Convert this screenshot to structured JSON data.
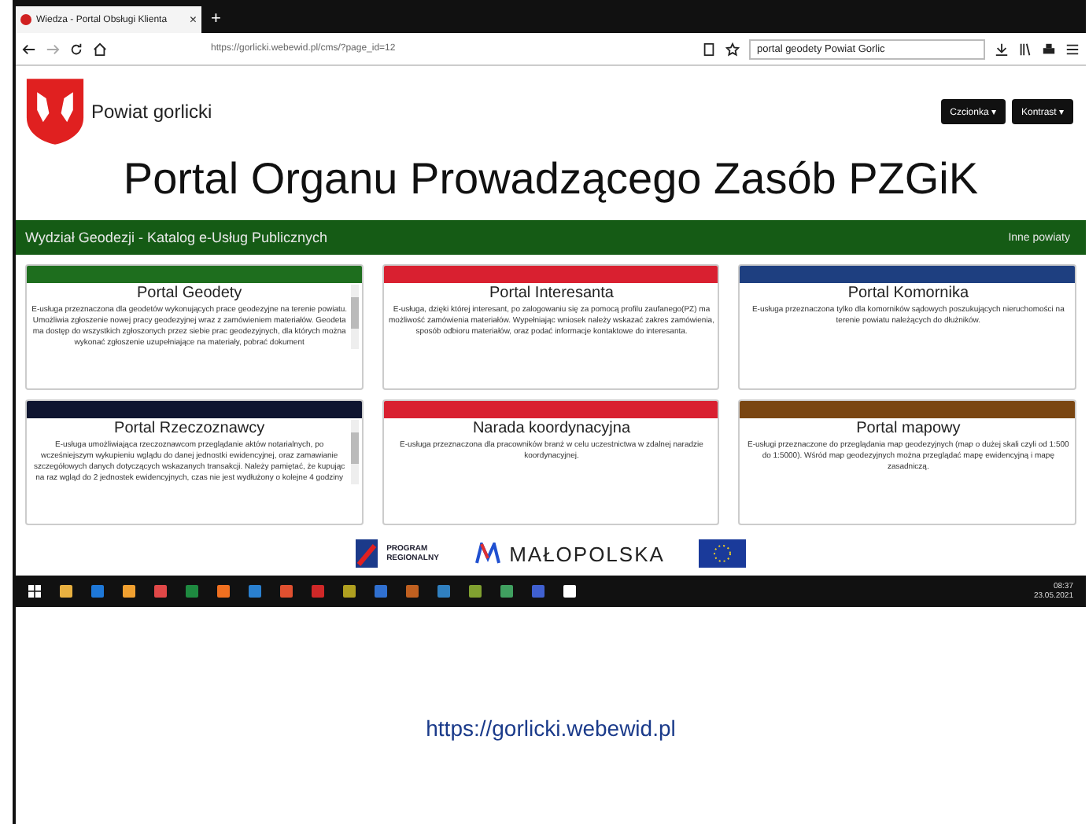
{
  "browser": {
    "tab_title": "Wiedza - Portal Obsługi Klienta",
    "tab_close": "×",
    "new_tab": "+",
    "url": "https://gorlicki.webewid.pl/cms/?page_id=12",
    "search_value": "portal geodety Powiat Gorlic"
  },
  "header": {
    "site_name": "Powiat gorlicki",
    "buttons": [
      "Czcionka ▾",
      "Kontrast ▾"
    ]
  },
  "title": "Portal Organu Prowadzącego Zasób PZGiK",
  "nav_bar": {
    "left": "Wydział Geodezji - Katalog e-Usług Publicznych",
    "right": "Inne powiaty"
  },
  "cards": [
    {
      "title": "Portal Geodety",
      "color": "#1e6e1e",
      "scrollable": true,
      "text": "E-usługa przeznaczona dla geodetów wykonujących prace geodezyjne na terenie powiatu. Umożliwia zgłoszenie nowej pracy geodezyjnej wraz z zamówieniem materiałów. Geodeta ma dostęp do wszystkich zgłoszonych przez siebie prac geodezyjnych, dla których można wykonać zgłoszenie uzupełniające na materiały, pobrać dokument"
    },
    {
      "title": "Portal Interesanta",
      "color": "#d92030",
      "scrollable": false,
      "text": "E-usługa, dzięki której interesant, po zalogowaniu się za pomocą profilu zaufanego(PZ) ma możliwość zamówienia materiałów. Wypełniając wniosek należy wskazać zakres zamówienia, sposób odbioru materiałów, oraz podać informacje kontaktowe do interesanta."
    },
    {
      "title": "Portal Komornika",
      "color": "#1e3f80",
      "scrollable": false,
      "text": "E-usługa przeznaczona tylko dla komorników sądowych poszukujących nieruchomości na terenie powiatu należących do dłużników."
    },
    {
      "title": "Portal Rzeczoznawcy",
      "color": "#0f1530",
      "scrollable": true,
      "text": "E-usługa umożliwiająca rzeczoznawcom przeglądanie aktów notarialnych, po wcześniejszym wykupieniu wglądu do danej jednostki ewidencyjnej, oraz zamawianie szczegółowych danych dotyczących wskazanych transakcji. Należy pamiętać, że kupując na raz wgląd do 2 jednostek ewidencyjnych, czas nie jest wydłużony o kolejne 4 godziny"
    },
    {
      "title": "Narada koordynacyjna",
      "color": "#d92030",
      "scrollable": false,
      "text": "E-usługa przeznaczona dla pracowników branż w celu uczestnictwa w zdalnej naradzie koordynacyjnej."
    },
    {
      "title": "Portal mapowy",
      "color": "#7a4612",
      "scrollable": false,
      "text": "E-usługi przeznaczone do przeglądania map geodezyjnych (map o dużej skali czyli od 1:500 do 1:5000). Wśród map geodezyjnych można przeglądać mapę ewidencyjną i mapę zasadniczą."
    }
  ],
  "footer_logos": {
    "program": "PROGRAM REGIONALNY",
    "region": "MAŁOPOLSKA"
  },
  "taskbar": {
    "time": "08:37",
    "date": "23.05.2021"
  },
  "link": "https://gorlicki.webewid.pl"
}
